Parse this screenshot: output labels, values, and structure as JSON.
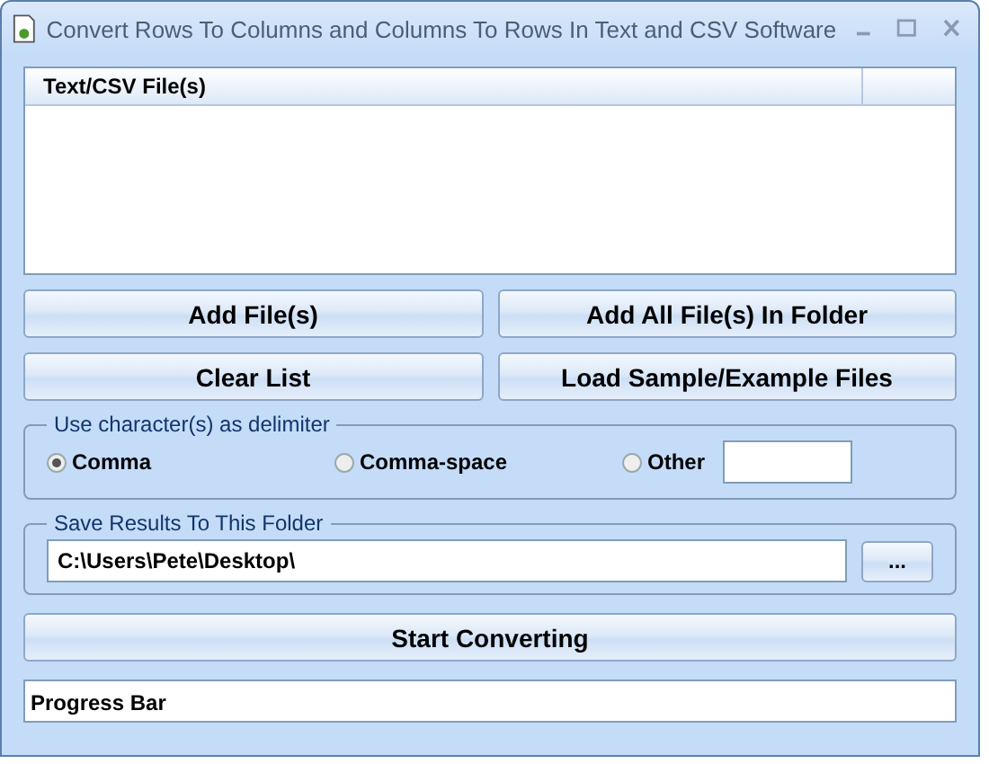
{
  "window": {
    "title": "Convert Rows To Columns and Columns To Rows In Text and CSV Software"
  },
  "file_list": {
    "columns": [
      "Text/CSV File(s)"
    ]
  },
  "buttons": [
    {
      "label": "Add File(s)"
    },
    {
      "label": "Add All File(s) In Folder"
    },
    {
      "label": "Clear List"
    },
    {
      "label": "Load Sample/Example Files"
    }
  ],
  "delimiter": {
    "title": "Use character(s) as delimiter",
    "options": [
      {
        "label": "Comma",
        "selected": true
      },
      {
        "label": "Comma-space",
        "selected": false
      },
      {
        "label": "Other",
        "selected": false
      }
    ]
  },
  "save_folder": {
    "title": "Save Results To This Folder",
    "path": "C:\\Users\\Pete\\Desktop\\",
    "browse_label": "..."
  },
  "start_button": {
    "label": "Start Converting"
  },
  "progress": {
    "label": "Progress Bar"
  }
}
